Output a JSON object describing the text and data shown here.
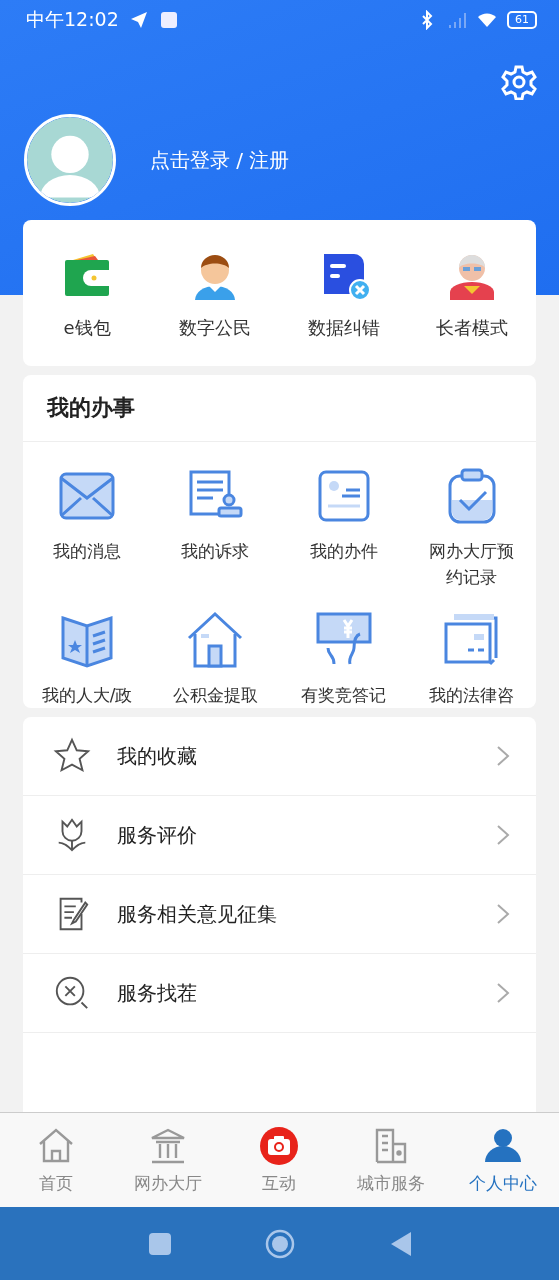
{
  "status_bar": {
    "time": "中午12:02",
    "battery": "61"
  },
  "profile": {
    "login_text": "点击登录 / 注册"
  },
  "quick_actions": [
    {
      "label": "e钱包",
      "kind": "wallet"
    },
    {
      "label": "数字公民",
      "kind": "citizen"
    },
    {
      "label": "数据纠错",
      "kind": "correction"
    },
    {
      "label": "长者模式",
      "kind": "elder"
    }
  ],
  "my_affairs": {
    "title": "我的办事",
    "items": [
      {
        "label": "我的消息",
        "kind": "mail"
      },
      {
        "label": "我的诉求",
        "kind": "petition"
      },
      {
        "label": "我的办件",
        "kind": "card"
      },
      {
        "label": "网办大厅预约记录",
        "kind": "clipboard"
      },
      {
        "label": "我的人大/政",
        "kind": "book"
      },
      {
        "label": "公积金提取",
        "kind": "house"
      },
      {
        "label": "有奖竞答记",
        "kind": "prize"
      },
      {
        "label": "我的法律咨",
        "kind": "legal"
      }
    ]
  },
  "menu": [
    {
      "label": "我的收藏",
      "kind": "star"
    },
    {
      "label": "服务评价",
      "kind": "flower"
    },
    {
      "label": "服务相关意见征集",
      "kind": "note"
    },
    {
      "label": "服务找茬",
      "kind": "search"
    }
  ],
  "tab_bar": [
    {
      "label": "首页",
      "kind": "home",
      "selected": false
    },
    {
      "label": "网办大厅",
      "kind": "hall",
      "selected": false
    },
    {
      "label": "互动",
      "kind": "camera",
      "selected": false
    },
    {
      "label": "城市服务",
      "kind": "city",
      "selected": false
    },
    {
      "label": "个人中心",
      "kind": "person",
      "selected": true
    }
  ]
}
